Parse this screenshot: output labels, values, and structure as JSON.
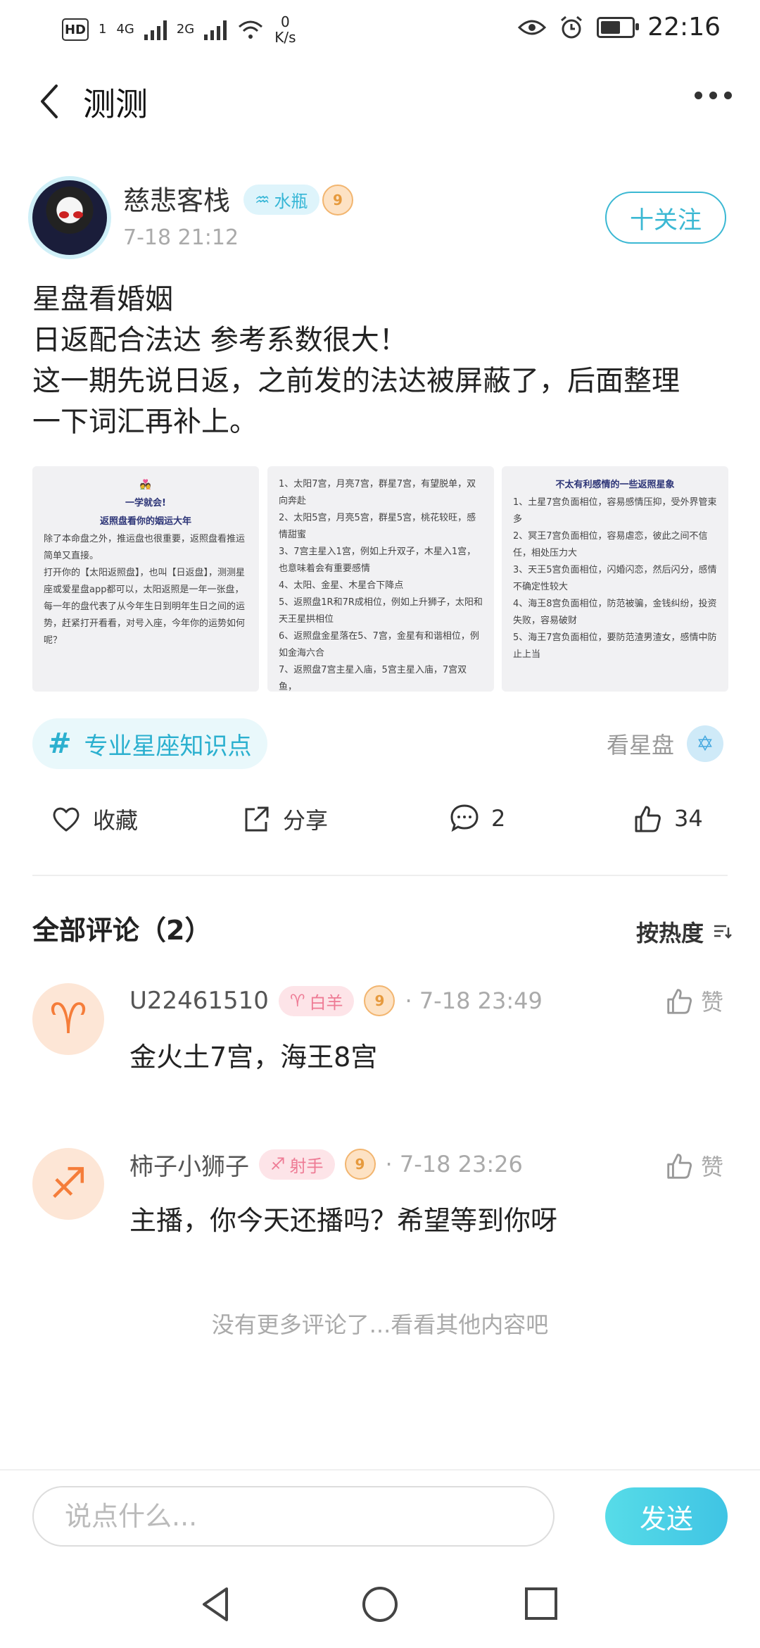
{
  "status_bar": {
    "hd": "HD",
    "sim": "1",
    "net1": "4G",
    "net2": "2G",
    "speed_value": "0",
    "speed_unit": "K/s",
    "time": "22:16"
  },
  "header": {
    "title": "测测"
  },
  "author": {
    "name": "慈悲客栈",
    "zodiac_tag": "水瓶",
    "level": "9",
    "time": "7-18 21:12",
    "follow_label": "十关注"
  },
  "post": {
    "lines": [
      "星盘看婚姻",
      "日返配合法达 参考系数很大！",
      "这一期先说日返，之前发的法达被屏蔽了，后面整理",
      "一下词汇再补上。"
    ],
    "images": [
      {
        "title_emoji": "💑",
        "title1": "一学就会!",
        "title2": "返照盘看你的姻运大年",
        "paragraphs": [
          "除了本命盘之外，推运盘也很重要，返照盘看推运简单又直接。",
          "打开你的【太阳返照盘】，也叫【日返盘】，测测星座或爱星盘app都可以，太阳返照是一年一张盘，每一年的盘代表了从今年生日到明年生日之间的运势，赶紧打开看看，对号入座，今年你的运势如何呢？"
        ]
      },
      {
        "items": [
          "1、太阳7宫，月亮7宫，群星7宫，有望脱单，双向奔赴",
          "2、太阳5宫，月亮5宫，群星5宫，桃花较旺，感情甜蜜",
          "3、7宫主星入1宫，例如上升双子，木星入1宫，也意味着会有重要感情",
          "4、太阳、金星、木星合下降点",
          "5、返照盘1R和7R成相位，例如上升狮子，太阳和天王星拱相位",
          "6、返照盘金星落在5、7宫，金星有和谐相位，例如金海六合",
          "7、返照盘7宫主星入庙，5宫主星入庙，7宫双鱼，"
        ]
      },
      {
        "title": "不太有利感情的一些返照星象",
        "items": [
          "1、土星7宫负面相位，容易感情压抑，受外界管束多",
          "2、冥王7宫负面相位，容易虐恋，彼此之间不信任，相处压力大",
          "3、天王5宫负面相位，闪婚闪恋，然后闪分，感情不确定性较大",
          "4、海王8宫负面相位，防范被骗，金钱纠纷，投资失败，容易破财",
          "5、海王7宫负面相位，要防范渣男渣女，感情中防止上当"
        ]
      }
    ],
    "topic": "专业星座知识点",
    "topic_right": "看星盘"
  },
  "actions": {
    "collect": "收藏",
    "share": "分享",
    "comments": "2",
    "likes": "34"
  },
  "comments_section": {
    "title": "全部评论（2）",
    "sort": "按热度",
    "items": [
      {
        "symbol": "♈",
        "name": "U22461510",
        "tag": "白羊",
        "tag_symbol": "♈",
        "level": "9",
        "time": "· 7-18 23:49",
        "text": "金火土7宫，海王8宫",
        "like": "赞"
      },
      {
        "symbol": "♐",
        "name": "柿子小狮子",
        "tag": "射手",
        "tag_symbol": "♐",
        "level": "9",
        "time": "· 7-18 23:26",
        "text": "主播，你今天还播吗？希望等到你呀",
        "like": "赞"
      }
    ],
    "no_more": "没有更多评论了...看看其他内容吧"
  },
  "input_bar": {
    "placeholder": "说点什么...",
    "send": "发送"
  },
  "colors": {
    "accent": "#3bb8d3",
    "send_gradient_start": "#57dce8",
    "send_gradient_end": "#3fc4e4",
    "zodiac_fire": "#f57d3a"
  }
}
